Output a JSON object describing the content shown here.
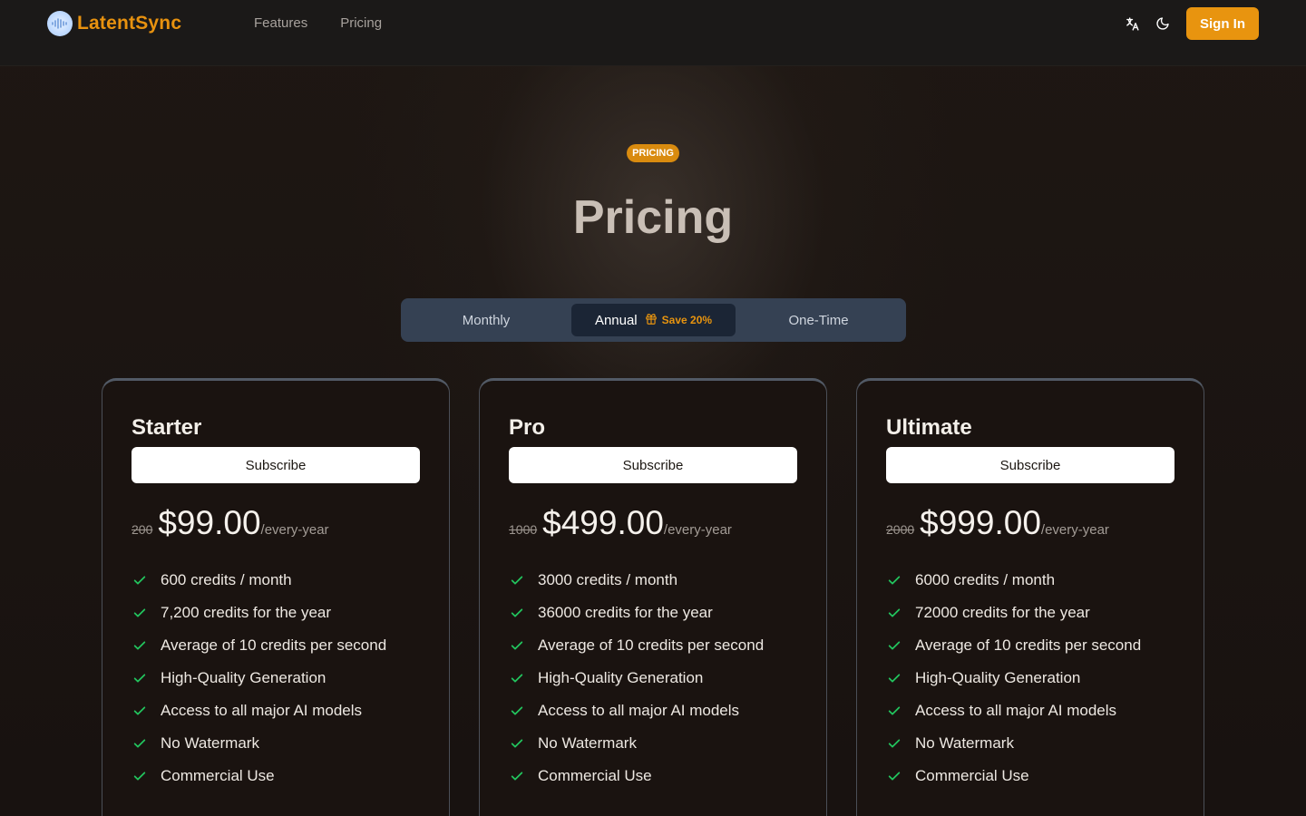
{
  "header": {
    "logo_text": "LatentSync",
    "nav": [
      "Features",
      "Pricing"
    ],
    "sign_in": "Sign In",
    "brand_color": "#e8940f"
  },
  "hero": {
    "badge": "PRICING",
    "title": "Pricing"
  },
  "billing_toggle": {
    "monthly": "Monthly",
    "annual": "Annual",
    "annual_save": "Save 20%",
    "one_time": "One-Time",
    "selected": "Annual"
  },
  "plans": [
    {
      "name": "Starter",
      "button": "Subscribe",
      "old_price": "200",
      "price": "$99.00",
      "period": "/every-year",
      "features": [
        "600 credits / month",
        "7,200 credits for the year",
        "Average of 10 credits per second",
        "High-Quality Generation",
        "Access to all major AI models",
        "No Watermark",
        "Commercial Use"
      ]
    },
    {
      "name": "Pro",
      "button": "Subscribe",
      "old_price": "1000",
      "price": "$499.00",
      "period": "/every-year",
      "features": [
        "3000 credits / month",
        "36000 credits for the year",
        "Average of 10 credits per second",
        "High-Quality Generation",
        "Access to all major AI models",
        "No Watermark",
        "Commercial Use"
      ]
    },
    {
      "name": "Ultimate",
      "button": "Subscribe",
      "old_price": "2000",
      "price": "$999.00",
      "period": "/every-year",
      "features": [
        "6000 credits / month",
        "72000 credits for the year",
        "Average of 10 credits per second",
        "High-Quality Generation",
        "Access to all major AI models",
        "No Watermark",
        "Commercial Use"
      ]
    }
  ]
}
